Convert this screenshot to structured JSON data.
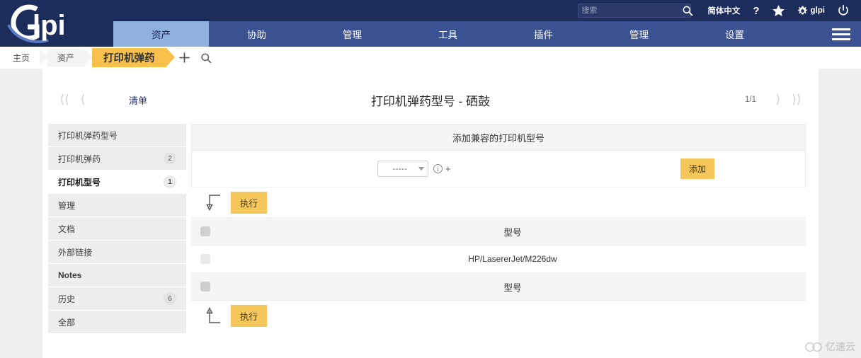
{
  "topbar": {
    "logo_text": "glpi",
    "search": {
      "placeholder": "搜索",
      "value": "",
      "icon": "search-icon"
    },
    "language": "简体中文",
    "help": "?",
    "favorites_icon": "star-icon",
    "settings_label": "glpi",
    "settings_icon": "gear-icon",
    "logout_icon": "power-icon"
  },
  "mainnav": {
    "items": [
      {
        "label": "资产",
        "active": true
      },
      {
        "label": "协助",
        "active": false
      },
      {
        "label": "管理",
        "active": false
      },
      {
        "label": "工具",
        "active": false
      },
      {
        "label": "插件",
        "active": false
      },
      {
        "label": "管理",
        "active": false
      },
      {
        "label": "设置",
        "active": false
      }
    ],
    "menu_icon": "hamburger-icon"
  },
  "breadcrumb": {
    "items": [
      {
        "label": "主页",
        "active": false
      },
      {
        "label": "资产",
        "active": false
      },
      {
        "label": "打印机弹药",
        "active": true
      }
    ],
    "add_icon": "plus-icon",
    "search_icon": "search-icon"
  },
  "titlebar": {
    "first_icon": "first-page-icon",
    "prev_icon": "prev-page-icon",
    "list_link": "清单",
    "title": "打印机弹药型号 - 硒鼓",
    "pager": "1/1",
    "next_icon": "next-page-icon",
    "last_icon": "last-page-icon"
  },
  "sidebar": {
    "items": [
      {
        "label": "打印机弹药型号",
        "badge": "",
        "active": false
      },
      {
        "label": "打印机弹药",
        "badge": "2",
        "active": false
      },
      {
        "label": "打印机型号",
        "badge": "1",
        "active": true
      },
      {
        "label": "管理",
        "badge": "",
        "active": false
      },
      {
        "label": "文档",
        "badge": "",
        "active": false
      },
      {
        "label": "外部链接",
        "badge": "",
        "active": false
      },
      {
        "label": "Notes",
        "badge": "",
        "active": false
      },
      {
        "label": "历史",
        "badge": "6",
        "active": false
      },
      {
        "label": "全部",
        "badge": "",
        "active": false
      }
    ]
  },
  "panel": {
    "header": "添加兼容的打印机型号",
    "dropdown": {
      "value": "-----",
      "caret_icon": "chevron-down-icon"
    },
    "info_icon": "info-icon",
    "plus_icon": "plus-icon",
    "add_button": "添加"
  },
  "massaction": {
    "top": {
      "arrow_icon": "arrow-down-left-icon",
      "button": "执行"
    },
    "bottom": {
      "arrow_icon": "arrow-up-left-icon",
      "button": "执行"
    }
  },
  "table": {
    "columns": [
      "型号"
    ],
    "header_checkbox": "checkbox",
    "rows": [
      {
        "checkbox": "checkbox",
        "model": "HP/LasererJet/M226dw"
      }
    ],
    "footer_columns": [
      "型号"
    ],
    "footer_checkbox": "checkbox"
  },
  "watermark": {
    "text": "亿速云",
    "icon": "cloud-logo-icon"
  },
  "colors": {
    "topbar_bg": "#1c2c5b",
    "nav_bg": "#3b5292",
    "nav_active_bg": "#8fb1de",
    "accent_amber": "#f5c659",
    "crumb_active": "#f7c14b",
    "link_navy": "#23306b"
  }
}
